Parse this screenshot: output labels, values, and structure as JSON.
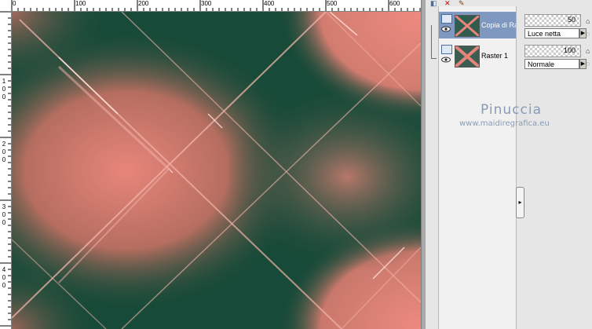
{
  "ruler": {
    "top_labels": [
      "0",
      "100",
      "200",
      "300",
      "400",
      "500",
      "600"
    ],
    "left_labels": [
      "1",
      "0",
      "0",
      "2",
      "0",
      "0",
      "3",
      "0",
      "0",
      "4",
      "0",
      "0"
    ]
  },
  "layers": [
    {
      "name": "Copia di Ra",
      "selected": true,
      "opacity": "50",
      "blend_mode": "Luce netta"
    },
    {
      "name": "Raster 1",
      "selected": false,
      "opacity": "100",
      "blend_mode": "Normale"
    }
  ],
  "watermark": {
    "name": "Pinuccia",
    "url": "www.maidiregrafica.eu"
  },
  "icons": {
    "layer_type": "raster-layer-icon",
    "visibility": "eye-icon",
    "collapse": "collapse-arrow-icon",
    "delete": "delete-layer-icon",
    "new_layer": "new-layer-icon"
  },
  "colors": {
    "dark_green": "#174a38",
    "salmon": "#e8857a",
    "highlight": "#f7c9c0",
    "selection": "#7f98bf"
  }
}
